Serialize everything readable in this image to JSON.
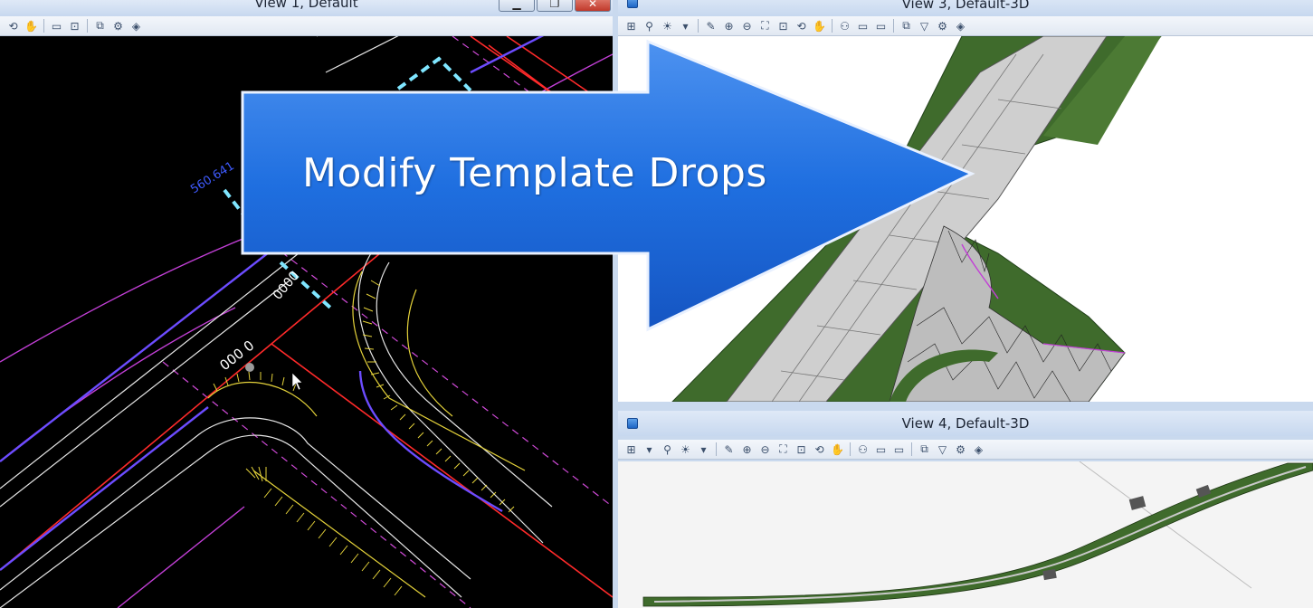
{
  "views": {
    "view1": {
      "title": "View 1, Default",
      "annotations": {
        "station_label": "560.641",
        "coord_label_a": "000 0",
        "coord_label_b": "0000"
      }
    },
    "view3": {
      "title": "View 3, Default-3D"
    },
    "view4": {
      "title": "View 4, Default-3D"
    }
  },
  "window_controls": {
    "minimize": "▁",
    "restore": "❐",
    "close": "✕"
  },
  "overlay": {
    "callout_text": "Modify Template Drops"
  },
  "toolbar_icons": {
    "view1": [
      "rotate-icon",
      "pan-icon",
      "window-area-icon",
      "fit-view-icon",
      "view-previous-icon",
      "view-attributes-icon",
      "render-icon"
    ],
    "view3d": [
      "view-group-icon",
      "lock-icon",
      "lighting-icon",
      "dropdown-icon",
      "pen-icon",
      "zoom-in-icon",
      "zoom-out-icon",
      "window-area-icon",
      "fit-view-icon",
      "rotate-icon",
      "pan-icon",
      "walk-icon",
      "view-previous-icon",
      "view-next-icon",
      "copy-view-icon",
      "clip-icon",
      "view-attributes-icon",
      "render-icon"
    ]
  },
  "colors": {
    "cad_background": "#000000",
    "arrow_fill": "#1f6fe0",
    "terrain_green": "#3f6b2c",
    "road_gray": "#c9c9c9"
  }
}
